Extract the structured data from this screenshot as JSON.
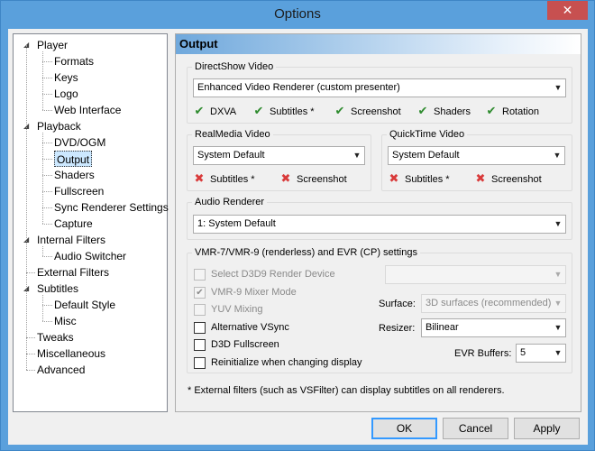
{
  "window": {
    "title": "Options",
    "close_glyph": "✕"
  },
  "tree": {
    "nodes": [
      {
        "label": "Player",
        "expandable": true
      },
      {
        "label": "Formats"
      },
      {
        "label": "Keys"
      },
      {
        "label": "Logo"
      },
      {
        "label": "Web Interface"
      },
      {
        "label": "Playback",
        "expandable": true
      },
      {
        "label": "DVD/OGM"
      },
      {
        "label": "Output",
        "selected": true
      },
      {
        "label": "Shaders"
      },
      {
        "label": "Fullscreen"
      },
      {
        "label": "Sync Renderer Settings"
      },
      {
        "label": "Capture"
      },
      {
        "label": "Internal Filters",
        "expandable": true
      },
      {
        "label": "Audio Switcher"
      },
      {
        "label": "External Filters"
      },
      {
        "label": "Subtitles",
        "expandable": true
      },
      {
        "label": "Default Style"
      },
      {
        "label": "Misc"
      },
      {
        "label": "Tweaks"
      },
      {
        "label": "Miscellaneous"
      },
      {
        "label": "Advanced"
      }
    ],
    "arrow_glyph": "◢"
  },
  "page": {
    "title": "Output",
    "directshow": {
      "label": "DirectShow Video",
      "renderer": "Enhanced Video Renderer (custom presenter)",
      "caps": [
        {
          "label": "DXVA",
          "ok": true
        },
        {
          "label": "Subtitles *",
          "ok": true
        },
        {
          "label": "Screenshot",
          "ok": true
        },
        {
          "label": "Shaders",
          "ok": true
        },
        {
          "label": "Rotation",
          "ok": true
        }
      ]
    },
    "realmedia": {
      "label": "RealMedia Video",
      "renderer": "System Default",
      "caps": [
        {
          "label": "Subtitles *",
          "ok": false
        },
        {
          "label": "Screenshot",
          "ok": false
        }
      ]
    },
    "quicktime": {
      "label": "QuickTime Video",
      "renderer": "System Default",
      "caps": [
        {
          "label": "Subtitles *",
          "ok": false
        },
        {
          "label": "Screenshot",
          "ok": false
        }
      ]
    },
    "audio": {
      "label": "Audio Renderer",
      "renderer": "1: System Default"
    },
    "vmr": {
      "label": "VMR-7/VMR-9 (renderless) and EVR (CP) settings",
      "select_d3d9": {
        "label": "Select D3D9 Render Device",
        "checked": false,
        "enabled": false
      },
      "d3d9_device": "",
      "vmr9_mixer": {
        "label": "VMR-9 Mixer Mode",
        "checked": true,
        "enabled": false
      },
      "yuv_mixing": {
        "label": "YUV Mixing",
        "checked": false,
        "enabled": false
      },
      "alt_vsync": {
        "label": "Alternative VSync",
        "checked": false,
        "enabled": true
      },
      "d3d_fullscreen": {
        "label": "D3D Fullscreen",
        "checked": false,
        "enabled": true
      },
      "reinit": {
        "label": "Reinitialize when changing display",
        "checked": false,
        "enabled": true
      },
      "surface_label": "Surface:",
      "surface_value": "3D surfaces (recommended)",
      "resizer_label": "Resizer:",
      "resizer_value": "Bilinear",
      "evr_buffers_label": "EVR Buffers:",
      "evr_buffers_value": "5"
    },
    "note": "* External filters (such as VSFilter) can display subtitles on all renderers."
  },
  "buttons": {
    "ok": "OK",
    "cancel": "Cancel",
    "apply": "Apply"
  },
  "glyphs": {
    "tick": "✔",
    "cross": "✖",
    "check": "✔",
    "chevron": "▼"
  },
  "colors": {
    "tick": "#2e8b2e",
    "cross": "#d93a3a",
    "selection": "#cce8ff",
    "titlebar": "#5aa0dc"
  }
}
